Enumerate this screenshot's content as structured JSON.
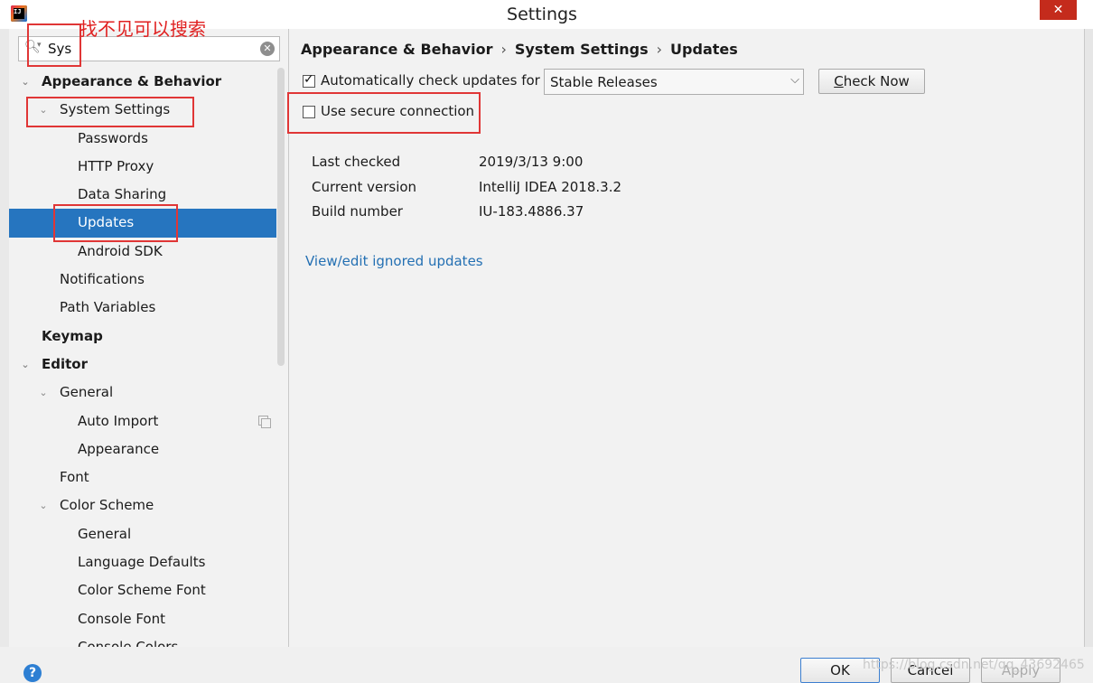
{
  "window": {
    "title": "Settings",
    "close_symbol": "✕",
    "app_icon_text": "IJ"
  },
  "search": {
    "value": "Sys",
    "clear_symbol": "✕"
  },
  "annotation": {
    "text": "找不见可以搜索",
    "color": "#e02020"
  },
  "tree": [
    {
      "label": "Appearance & Behavior",
      "level": 0,
      "bold": true,
      "arrow": "expanded"
    },
    {
      "label": "System Settings",
      "level": 1,
      "bold": false,
      "arrow": "expanded"
    },
    {
      "label": "Passwords",
      "level": 2
    },
    {
      "label": "HTTP Proxy",
      "level": 2
    },
    {
      "label": "Data Sharing",
      "level": 2
    },
    {
      "label": "Updates",
      "level": 2,
      "selected": true
    },
    {
      "label": "Android SDK",
      "level": 2
    },
    {
      "label": "Notifications",
      "level": 1
    },
    {
      "label": "Path Variables",
      "level": 1
    },
    {
      "label": "Keymap",
      "level": 0,
      "bold": true
    },
    {
      "label": "Editor",
      "level": 0,
      "bold": true,
      "arrow": "expanded"
    },
    {
      "label": "General",
      "level": 1,
      "arrow": "expanded"
    },
    {
      "label": "Auto Import",
      "level": 2,
      "copy_icon": true
    },
    {
      "label": "Appearance",
      "level": 2
    },
    {
      "label": "Font",
      "level": 1
    },
    {
      "label": "Color Scheme",
      "level": 1,
      "arrow": "expanded"
    },
    {
      "label": "General",
      "level": 2
    },
    {
      "label": "Language Defaults",
      "level": 2
    },
    {
      "label": "Color Scheme Font",
      "level": 2
    },
    {
      "label": "Console Font",
      "level": 2
    },
    {
      "label": "Console Colors",
      "level": 2
    }
  ],
  "breadcrumb": {
    "part1": "Appearance & Behavior",
    "part2": "System Settings",
    "part3": "Updates",
    "separator": "›"
  },
  "updates": {
    "auto_check_label": "Automatically check updates for",
    "auto_check_checked": true,
    "channel": "Stable Releases",
    "check_now_mnemonic": "C",
    "check_now_rest": "heck Now",
    "secure_label": "Use secure connection",
    "secure_checked": false
  },
  "info": {
    "last_checked_label": "Last checked",
    "last_checked_value": "2019/3/13 9:00",
    "current_version_label": "Current version",
    "current_version_value": "IntelliJ IDEA 2018.3.2",
    "build_number_label": "Build number",
    "build_number_value": "IU-183.4886.37"
  },
  "link": "View/edit ignored updates",
  "footer": {
    "ok": "OK",
    "cancel": "Cancel",
    "apply": "Apply",
    "help_symbol": "?"
  },
  "watermark": "https://blog.csdn.net/qq_43692465",
  "colors": {
    "selection": "#2675bf",
    "link": "#2470b3",
    "annotation_red": "#e03636"
  }
}
